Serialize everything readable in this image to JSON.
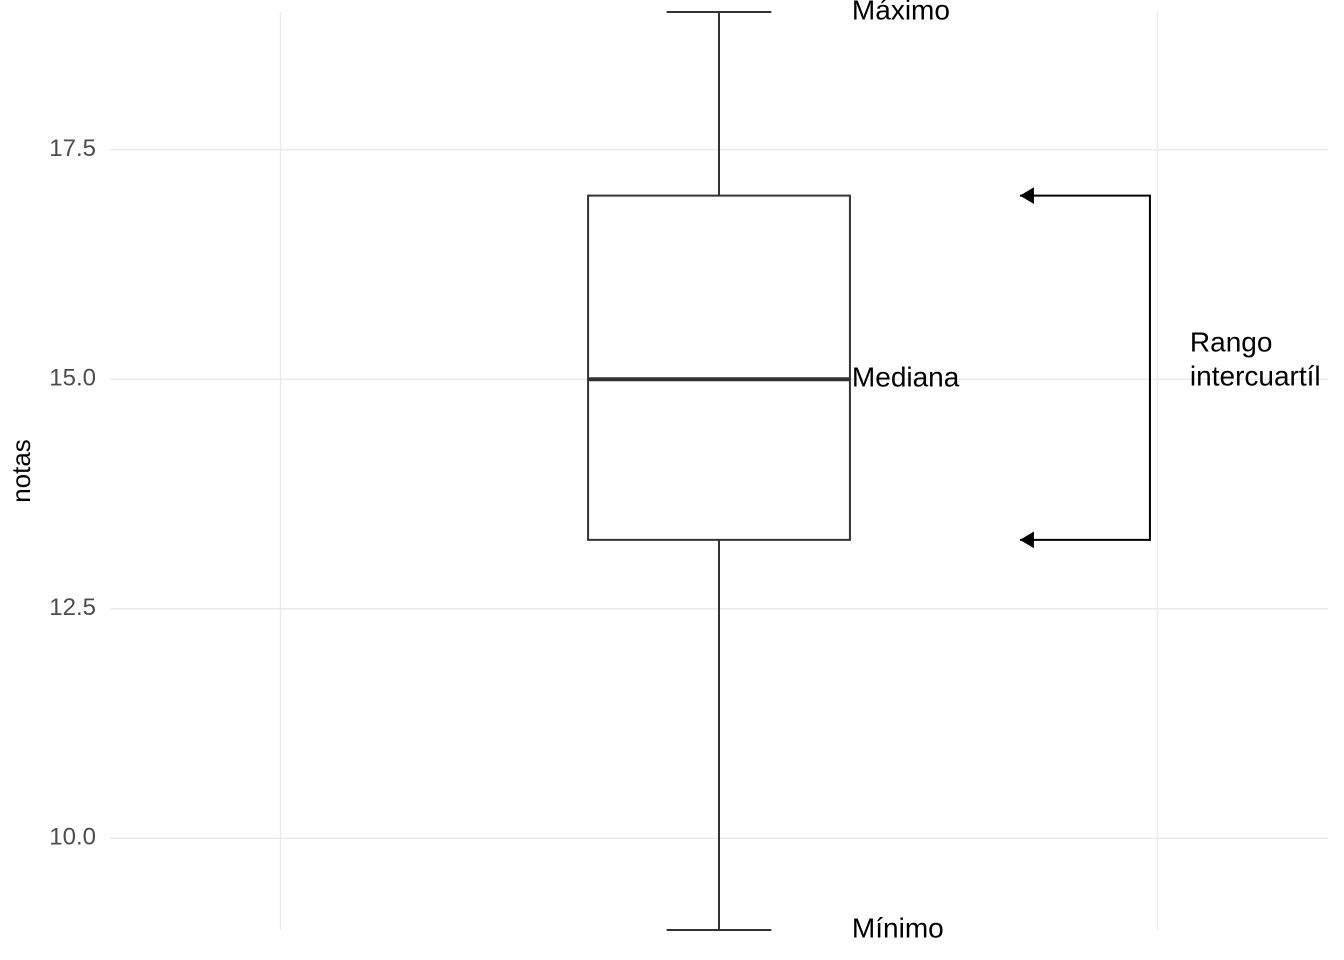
{
  "chart_data": {
    "type": "boxplot",
    "ylabel": "notas",
    "ylim": [
      9,
      19
    ],
    "y_ticks": [
      10.0,
      12.5,
      15.0,
      17.5
    ],
    "y_tick_labels": [
      "10.0",
      "12.5",
      "15.0",
      "17.5"
    ],
    "stats": {
      "min": 9.0,
      "q1": 13.25,
      "median": 15.0,
      "q3": 17.0,
      "max": 19.0
    },
    "annotations": {
      "max_label": "Máximo",
      "median_label": "Mediana",
      "min_label": "Mínimo",
      "iqr_label_line1": "Rango",
      "iqr_label_line2": "intercuartíl"
    }
  }
}
